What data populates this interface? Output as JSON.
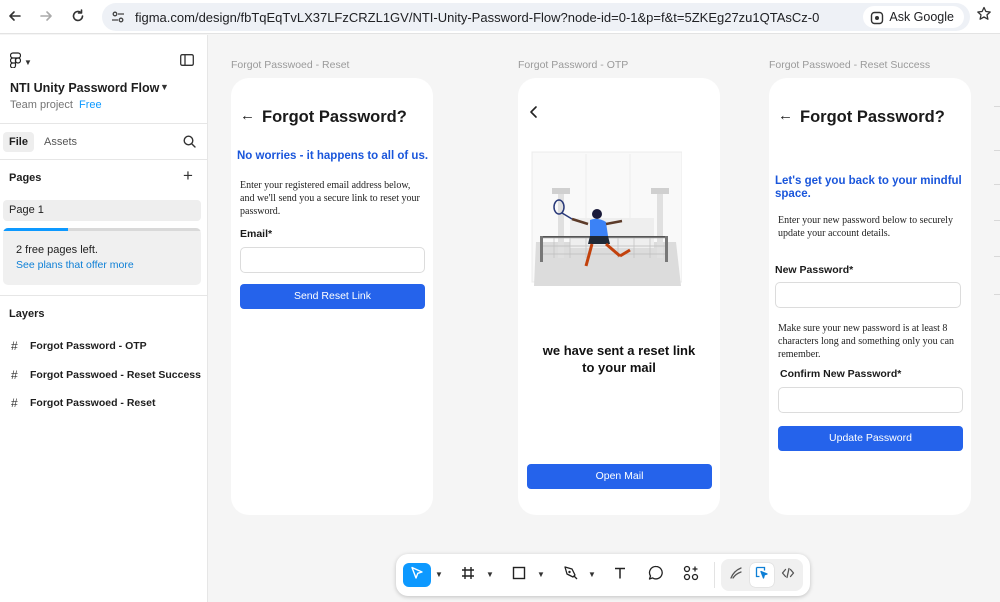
{
  "browser": {
    "url": "figma.com/design/fbTqEqTvLX37LFzCRZL1GV/NTI-Unity-Password-Flow?node-id=0-1&p=f&t=5ZKEg27zu1QTAsCz-0",
    "ask_google": "Ask Google"
  },
  "sidebar": {
    "project_name": "NTI Unity Password Flow",
    "team_label": "Team project",
    "plan_badge": "Free",
    "tabs": {
      "file": "File",
      "assets": "Assets"
    },
    "pages_heading": "Pages",
    "current_page": "Page 1",
    "free_pages_text": "2 free pages left.",
    "plans_link": "See plans that offer more",
    "free_pages_progress": 0.33,
    "layers_heading": "Layers",
    "layers": [
      "Forgot Password - OTP",
      "Forgot Passwoed - Reset Success",
      "Forgot Passwoed - Reset"
    ]
  },
  "frames": {
    "reset": {
      "title": "Forgot Passwoed - Reset",
      "heading": "Forgot Password?",
      "subheading": "No worries - it happens to all of us.",
      "body": "Enter your registered  email address below, and we'll send you a secure link to reset your password.",
      "email_label": "Email*",
      "button": "Send Reset Link"
    },
    "otp": {
      "title": "Forgot Password - OTP",
      "message_line1": "we have sent a reset link",
      "message_line2": "to your mail",
      "button": "Open Mail"
    },
    "success": {
      "title": "Forgot Passwoed - Reset Success",
      "heading": "Forgot Password?",
      "subheading": "Let's get you back to your mindful space.",
      "body": "Enter your new password below to securely update your account details.",
      "new_password_label": "New Password*",
      "hint": "Make sure your new password is at least 8 characters long and something only you can remember.",
      "confirm_label": "Confirm New Password*",
      "button": "Update Password"
    }
  },
  "colors": {
    "accent": "#0d99ff",
    "primary_button": "#2563eb",
    "subheading_blue": "#1a56db"
  }
}
